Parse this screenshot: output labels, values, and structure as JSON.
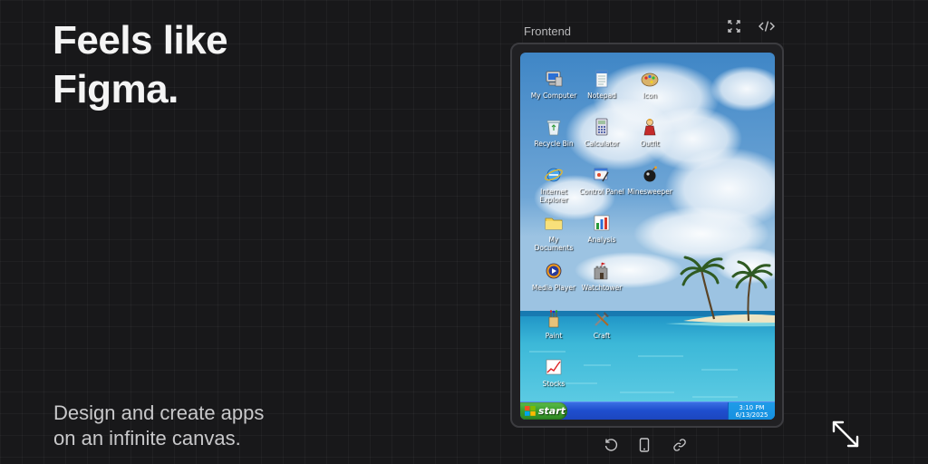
{
  "hero": {
    "headline_line1": "Feels like",
    "headline_line2": "Figma.",
    "tagline_line1": "Design and create apps",
    "tagline_line2": "on an infinite canvas."
  },
  "frame": {
    "title": "Frontend",
    "top_icons": [
      "fullscreen-icon",
      "code-icon"
    ],
    "bottom_icons": [
      "undo-icon",
      "mobile-device-icon",
      "link-icon"
    ]
  },
  "desktop": {
    "icons": [
      {
        "label": "My Computer",
        "icon": "computer-icon"
      },
      {
        "label": "Notepad",
        "icon": "notepad-icon"
      },
      {
        "label": "Icon",
        "icon": "palette-icon"
      },
      {
        "label": "Recycle Bin",
        "icon": "recycle-bin-icon"
      },
      {
        "label": "Calculator",
        "icon": "calculator-icon"
      },
      {
        "label": "Outfit",
        "icon": "outfit-icon"
      },
      {
        "label": "Internet Explorer",
        "icon": "internet-explorer-icon"
      },
      {
        "label": "Control Panel",
        "icon": "control-panel-icon"
      },
      {
        "label": "Minesweeper",
        "icon": "mine-icon"
      },
      {
        "label": "My Documents",
        "icon": "folder-icon"
      },
      {
        "label": "Analysis",
        "icon": "bar-chart-icon"
      },
      {
        "label": "Media Player",
        "icon": "media-player-icon"
      },
      {
        "label": "Watchtower",
        "icon": "castle-icon"
      },
      {
        "label": "Paint",
        "icon": "paint-icon"
      },
      {
        "label": "Craft",
        "icon": "tools-icon"
      },
      {
        "label": "Stocks",
        "icon": "stocks-icon"
      }
    ]
  },
  "taskbar": {
    "start_label": "start",
    "time": "3:10 PM",
    "date": "6/13/2025"
  },
  "colors": {
    "background": "#18181a",
    "taskbar_blue": "#1f4fcf",
    "start_green": "#3a9c2c"
  }
}
